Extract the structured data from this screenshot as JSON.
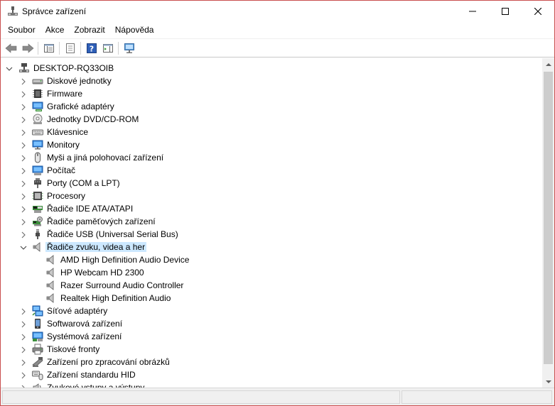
{
  "window": {
    "title": "Správce zařízení"
  },
  "menu": [
    "Soubor",
    "Akce",
    "Zobrazit",
    "Nápověda"
  ],
  "toolbar": [
    "back-icon",
    "forward-icon",
    "show-hide-console-tree-icon",
    "properties-icon",
    "help-icon",
    "action-pane-icon",
    "scan-hardware-icon"
  ],
  "tree": {
    "root": "DESKTOP-RQ33OIB",
    "categories": [
      {
        "label": "Diskové jednotky",
        "icon": "disk-drive-icon"
      },
      {
        "label": "Firmware",
        "icon": "firmware-icon"
      },
      {
        "label": "Grafické adaptéry",
        "icon": "display-adapter-icon"
      },
      {
        "label": "Jednotky DVD/CD-ROM",
        "icon": "dvd-drive-icon"
      },
      {
        "label": "Klávesnice",
        "icon": "keyboard-icon"
      },
      {
        "label": "Monitory",
        "icon": "monitor-icon"
      },
      {
        "label": "Myši a jiná polohovací zařízení",
        "icon": "mouse-icon"
      },
      {
        "label": "Počítač",
        "icon": "computer-icon"
      },
      {
        "label": "Porty (COM a LPT)",
        "icon": "port-icon"
      },
      {
        "label": "Procesory",
        "icon": "processor-icon"
      },
      {
        "label": "Řadiče IDE ATA/ATAPI",
        "icon": "ide-controller-icon"
      },
      {
        "label": "Řadiče paměťových zařízení",
        "icon": "storage-controller-icon"
      },
      {
        "label": "Řadiče USB (Universal Serial Bus)",
        "icon": "usb-icon"
      },
      {
        "label": "Řadiče zvuku, videa a her",
        "icon": "speaker-icon",
        "expanded": true,
        "selected": true,
        "children": [
          "AMD High Definition Audio Device",
          "HP Webcam HD 2300",
          "Razer Surround Audio Controller",
          "Realtek High Definition Audio"
        ]
      },
      {
        "label": "Síťové adaptéry",
        "icon": "network-adapter-icon"
      },
      {
        "label": "Softwarová zařízení",
        "icon": "software-device-icon"
      },
      {
        "label": "Systémová zařízení",
        "icon": "system-device-icon"
      },
      {
        "label": "Tiskové fronty",
        "icon": "printer-icon"
      },
      {
        "label": "Zařízení pro zpracování obrázků",
        "icon": "imaging-device-icon"
      },
      {
        "label": "Zařízení standardu HID",
        "icon": "hid-icon"
      },
      {
        "label": "Zvukové vstupy a výstupy",
        "icon": "audio-io-icon"
      }
    ]
  },
  "colors": {
    "selection": "#cce8ff",
    "window_border": "#c94f4f",
    "accent": "#1e6fc6"
  }
}
